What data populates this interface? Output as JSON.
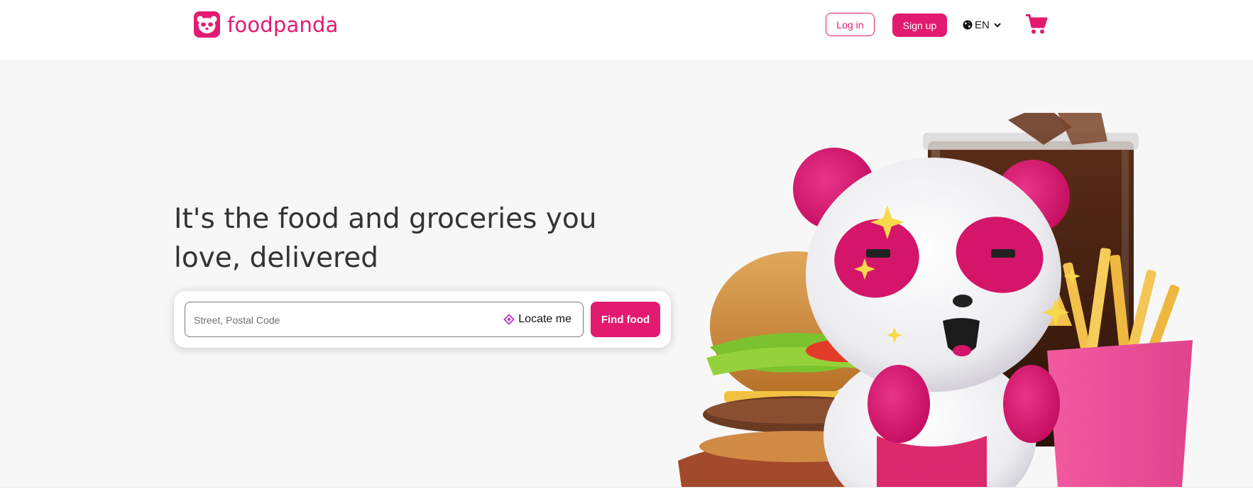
{
  "brand": {
    "name": "foodpanda",
    "color": "#e21b70"
  },
  "header": {
    "login_label": "Log in",
    "signup_label": "Sign up",
    "language": "EN",
    "icons": [
      "panda-logo-icon",
      "globe-icon",
      "chevron-down-icon",
      "cart-icon"
    ]
  },
  "hero": {
    "headline": "It's the food and groceries you love, delivered",
    "search": {
      "placeholder": "Street, Postal Code",
      "value": "",
      "locate_label": "Locate me",
      "submit_label": "Find food"
    },
    "illustration": "panda mascot with burger, cola and fries"
  }
}
